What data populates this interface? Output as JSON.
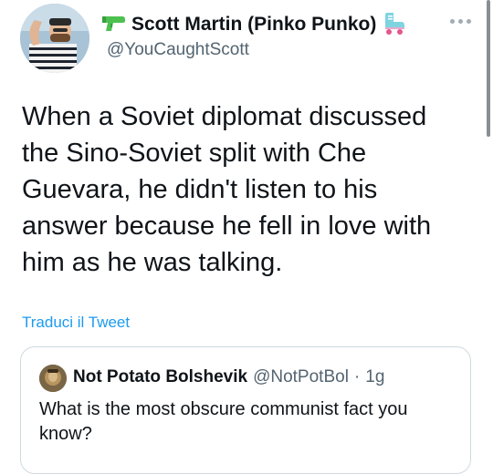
{
  "author": {
    "display_name": "Scott Martin (Pinko Punko)",
    "handle": "@YouCaughtScott",
    "name_icons": [
      "water-pistol-icon",
      "roller-skate-icon"
    ]
  },
  "tweet": {
    "text": "When a Soviet diplomat discussed\nthe Sino-Soviet split with Che\nGuevara, he didn't listen to his\nanswer because he fell in love with\nhim as he was talking.",
    "translate_label": "Traduci il Tweet"
  },
  "quoted_tweet": {
    "display_name": "Not Potato Bolshevik",
    "handle": "@NotPotBol",
    "separator": "·",
    "time": "1g",
    "text": "What is the most obscure communist fact you know?"
  },
  "colors": {
    "link": "#1d9bf0",
    "secondary_text": "#536471",
    "border": "#cfd9de"
  }
}
